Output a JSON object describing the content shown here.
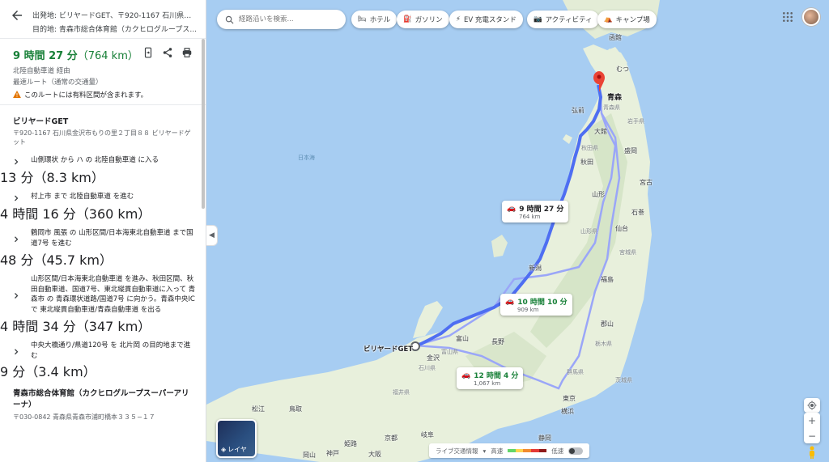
{
  "header": {
    "origin_line": "出発地: ビリヤードGET、〒920-1167 石川県金沢...",
    "destination_line": "目的地: 青森市総合体育館（カクヒログループス..."
  },
  "summary": {
    "duration": "9 時間 27 分",
    "distance": "（764 km）",
    "via": "北陸自動車道 経由",
    "route_type": "最速ルート（通常の交通量）",
    "toll_warning": "このルートには有料区間が含まれます。"
  },
  "origin": {
    "name": "ビリヤードGET",
    "address": "〒920-1167 石川県金沢市もりの里２丁目８８ ビリヤードゲット"
  },
  "steps": [
    {
      "text": "山側環状 から ハ の 北陸自動車道 に入る",
      "meta": "13 分（8.3 km）"
    },
    {
      "text": "村上市 まで 北陸自動車道 を進む",
      "meta": "4 時間 16 分（360 km）"
    },
    {
      "text": "鶴岡市 風張 の 山形区間/日本海東北自動車道 まで国道7号 を進む",
      "meta": "48 分（45.7 km）"
    },
    {
      "text": "山形区間/日本海東北自動車道 を進み、秋田区間、秋田自動車道、国道7号、東北縦貫自動車道に入って 青森市 の 青森環状道路/国道7号 に向かう。青森中央IC で 東北縦貫自動車道/青森自動車道 を出る",
      "meta": "4 時間 34 分（347 km）"
    },
    {
      "text": "中央大橋通り/県道120号 を 北片岡 の目的地まで進む",
      "meta": "9 分（3.4 km）"
    }
  ],
  "destination": {
    "name": "青森市総合体育館（カクヒログループスーパーアリーナ）",
    "address": "〒030-0842 青森県青森市浦町橋本３３５−１７"
  },
  "map": {
    "search_placeholder": "経路沿いを検索...",
    "chips": [
      "ホテル",
      "ガソリン",
      "EV 充電スタンド",
      "アクティビティ",
      "キャンプ場"
    ],
    "routes": [
      {
        "time": "9 時間 27 分",
        "distance": "764 km"
      },
      {
        "time": "10 時間 10 分",
        "distance": "909 km"
      },
      {
        "time": "12 時間 4 分",
        "distance": "1,067 km"
      }
    ],
    "origin_label": "ビリヤードGET",
    "destination_label": "青森",
    "sea_label": "日本海",
    "cities": [
      "函館",
      "むつ",
      "弘前",
      "大館",
      "秋田",
      "盛岡",
      "酒田",
      "新潟",
      "仙台",
      "福島",
      "長野",
      "富山",
      "金沢",
      "東京",
      "横浜",
      "静岡",
      "京都",
      "大阪",
      "岐阜",
      "松江",
      "鳥取",
      "神戸",
      "岡山",
      "姫路",
      "山形",
      "郡山",
      "石巻",
      "宮古"
    ],
    "prefectures": [
      "青森県",
      "秋田県",
      "岩手県",
      "山形県",
      "宮城県",
      "新潟県",
      "富山県",
      "石川県",
      "福井県",
      "群馬県",
      "栃木県",
      "茨城県"
    ],
    "layer_label": "レイヤ",
    "traffic": {
      "label": "ライブ交通情報",
      "fast": "高速",
      "slow": "低速",
      "colors": [
        "#63d668",
        "#ffd54f",
        "#f28b30",
        "#e53935",
        "#8e1a1a"
      ]
    }
  },
  "colors": {
    "primary_route": "#4e6ef2",
    "alt_route": "#9aa6f8",
    "duration_green": "#188038",
    "water": "#a7cdf2",
    "land": "#e8f0dc"
  }
}
